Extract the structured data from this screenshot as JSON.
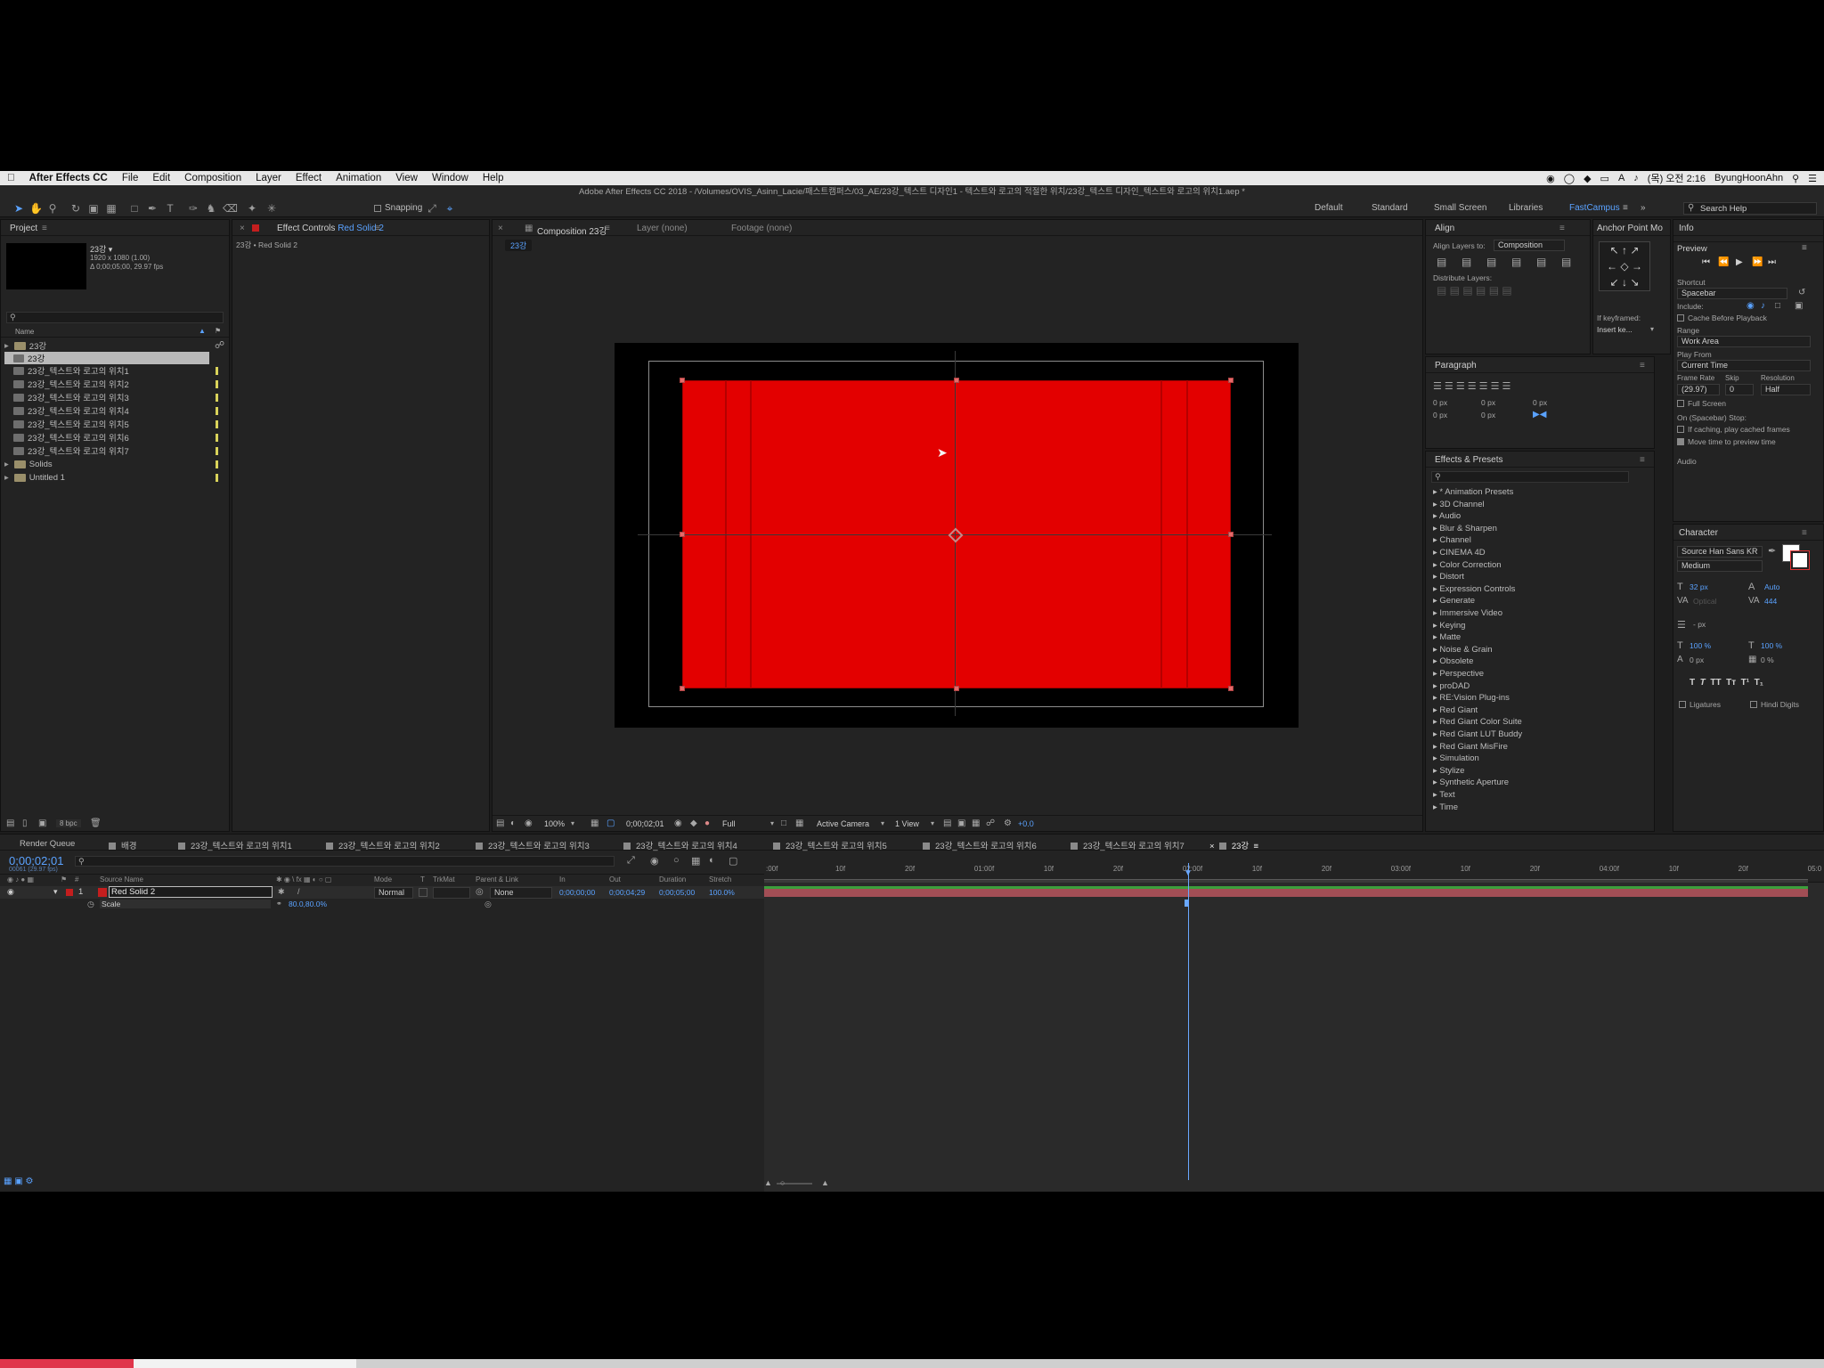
{
  "menubar": {
    "app_name": "After Effects CC",
    "items": [
      "File",
      "Edit",
      "Composition",
      "Layer",
      "Effect",
      "Animation",
      "View",
      "Window",
      "Help"
    ],
    "clock": "(목) 오전 2:16",
    "user": "ByungHoonAhn"
  },
  "window_title": "Adobe After Effects CC 2018 - /Volumes/OVIS_Asinn_Lacie/패스트캠퍼스/03_AE/23강_텍스트 디자인1 - 텍스트와 로고의 적절한 위치/23강_텍스트 디자인_텍스트와 로고의 위치1.aep *",
  "toolbar": {
    "snapping_label": "Snapping",
    "workspaces": [
      "Default",
      "Standard",
      "Small Screen",
      "Libraries",
      "FastCampus"
    ],
    "active_workspace": "FastCampus",
    "search_placeholder": "Search Help"
  },
  "project": {
    "tab_label": "Project",
    "thumb_name": "23강 ▾",
    "thumb_info1": "1920 x 1080 (1.00)",
    "thumb_info2": "Δ 0;00;05;00, 29.97 fps",
    "column_name": "Name",
    "items": [
      "23강",
      "23강",
      "23강_텍스트와 로고의 위치1",
      "23강_텍스트와 로고의 위치2",
      "23강_텍스트와 로고의 위치3",
      "23강_텍스트와 로고의 위치4",
      "23강_텍스트와 로고의 위치5",
      "23강_텍스트와 로고의 위치6",
      "23강_텍스트와 로고의 위치7",
      "Solids",
      "Untitled 1"
    ],
    "bpc": "8 bpc"
  },
  "effect_controls": {
    "tab_prefix": "Effect Controls",
    "tab_layer": "Red Solid 2",
    "breadcrumb": "23강 • Red Solid 2"
  },
  "viewer": {
    "tab_comp": "Composition 23강",
    "tab_layer": "Layer (none)",
    "tab_footage": "Footage (none)",
    "comp_chip": "23강",
    "zoom": "100%",
    "timecode": "0;00;02;01",
    "resolution": "Full",
    "camera": "Active Camera",
    "view": "1 View",
    "exposure": "+0.0"
  },
  "align": {
    "title": "Align",
    "align_to_label": "Align Layers to:",
    "align_to_value": "Composition",
    "distribute_label": "Distribute Layers:"
  },
  "anchor": {
    "title": "Anchor Point Mo",
    "if_keyframed": "If keyframed:",
    "insert_value": "Insert ke..."
  },
  "info": {
    "title": "Info"
  },
  "preview": {
    "title": "Preview",
    "shortcut_label": "Shortcut",
    "shortcut_value": "Spacebar",
    "include_label": "Include:",
    "cache_label": "Cache Before Playback",
    "range_label": "Range",
    "range_value": "Work Area",
    "play_from_label": "Play From",
    "play_from_value": "Current Time",
    "frame_rate_label": "Frame Rate",
    "skip_label": "Skip",
    "resolution_label": "Resolution",
    "frame_rate_value": "(29.97)",
    "skip_value": "0",
    "resolution_value": "Half",
    "full_screen_label": "Full Screen",
    "on_stop_label": "On (Spacebar) Stop:",
    "if_caching_label": "If caching, play cached frames",
    "move_time_label": "Move time to preview time",
    "audio_label": "Audio"
  },
  "paragraph": {
    "title": "Paragraph",
    "values": [
      "0 px",
      "0 px",
      "0 px",
      "0 px",
      "0 px"
    ]
  },
  "effects_presets": {
    "title": "Effects & Presets",
    "items": [
      "* Animation Presets",
      "3D Channel",
      "Audio",
      "Blur & Sharpen",
      "Channel",
      "CINEMA 4D",
      "Color Correction",
      "Distort",
      "Expression Controls",
      "Generate",
      "Immersive Video",
      "Keying",
      "Matte",
      "Noise & Grain",
      "Obsolete",
      "Perspective",
      "proDAD",
      "RE:Vision Plug-ins",
      "Red Giant",
      "Red Giant Color Suite",
      "Red Giant LUT Buddy",
      "Red Giant MisFire",
      "Simulation",
      "Stylize",
      "Synthetic Aperture",
      "Text",
      "Time"
    ]
  },
  "character": {
    "title": "Character",
    "font": "Source Han Sans KR",
    "weight": "Medium",
    "size": "32 px",
    "leading": "Auto",
    "kerning": "Optical",
    "tracking": "444",
    "indent": "- px",
    "vert_scale": "100 %",
    "horiz_scale": "100 %",
    "baseline": "0 px",
    "tsume": "0 %",
    "ligatures_label": "Ligatures",
    "hindi_label": "Hindi Digits"
  },
  "timeline": {
    "tabs": [
      "Render Queue",
      "배경",
      "23강_텍스트와 로고의 위치1",
      "23강_텍스트와 로고의 위치2",
      "23강_텍스트와 로고의 위치3",
      "23강_텍스트와 로고의 위치4",
      "23강_텍스트와 로고의 위치5",
      "23강_텍스트와 로고의 위치6",
      "23강_텍스트와 로고의 위치7",
      "23강"
    ],
    "current_time": "0;00;02;01",
    "frame_info": "00061 (29.97 fps)",
    "col_source_name": "Source Name",
    "col_mode": "Mode",
    "col_t": "T",
    "col_trkmat": "TrkMat",
    "col_parent": "Parent & Link",
    "col_in": "In",
    "col_out": "Out",
    "col_duration": "Duration",
    "col_stretch": "Stretch",
    "layer_num": "1",
    "layer_name": "Red Solid 2",
    "layer_mode": "Normal",
    "layer_parent": "None",
    "layer_in": "0;00;00;00",
    "layer_out": "0;00;04;29",
    "layer_duration": "0;00;05;00",
    "layer_stretch": "100.0%",
    "prop_name": "Scale",
    "prop_value": "80.0,80.0%",
    "ruler": [
      ":00f",
      "10f",
      "20f",
      "01:00f",
      "10f",
      "20f",
      "02:00f",
      "10f",
      "20f",
      "03:00f",
      "10f",
      "20f",
      "04:00f",
      "10f",
      "20f",
      "05:0"
    ]
  },
  "colors": {
    "solid_red": "#e30000",
    "accent_blue": "#5aa2ff",
    "layer_bar": "#a24e55",
    "work_area_green": "#3c9f3c"
  }
}
